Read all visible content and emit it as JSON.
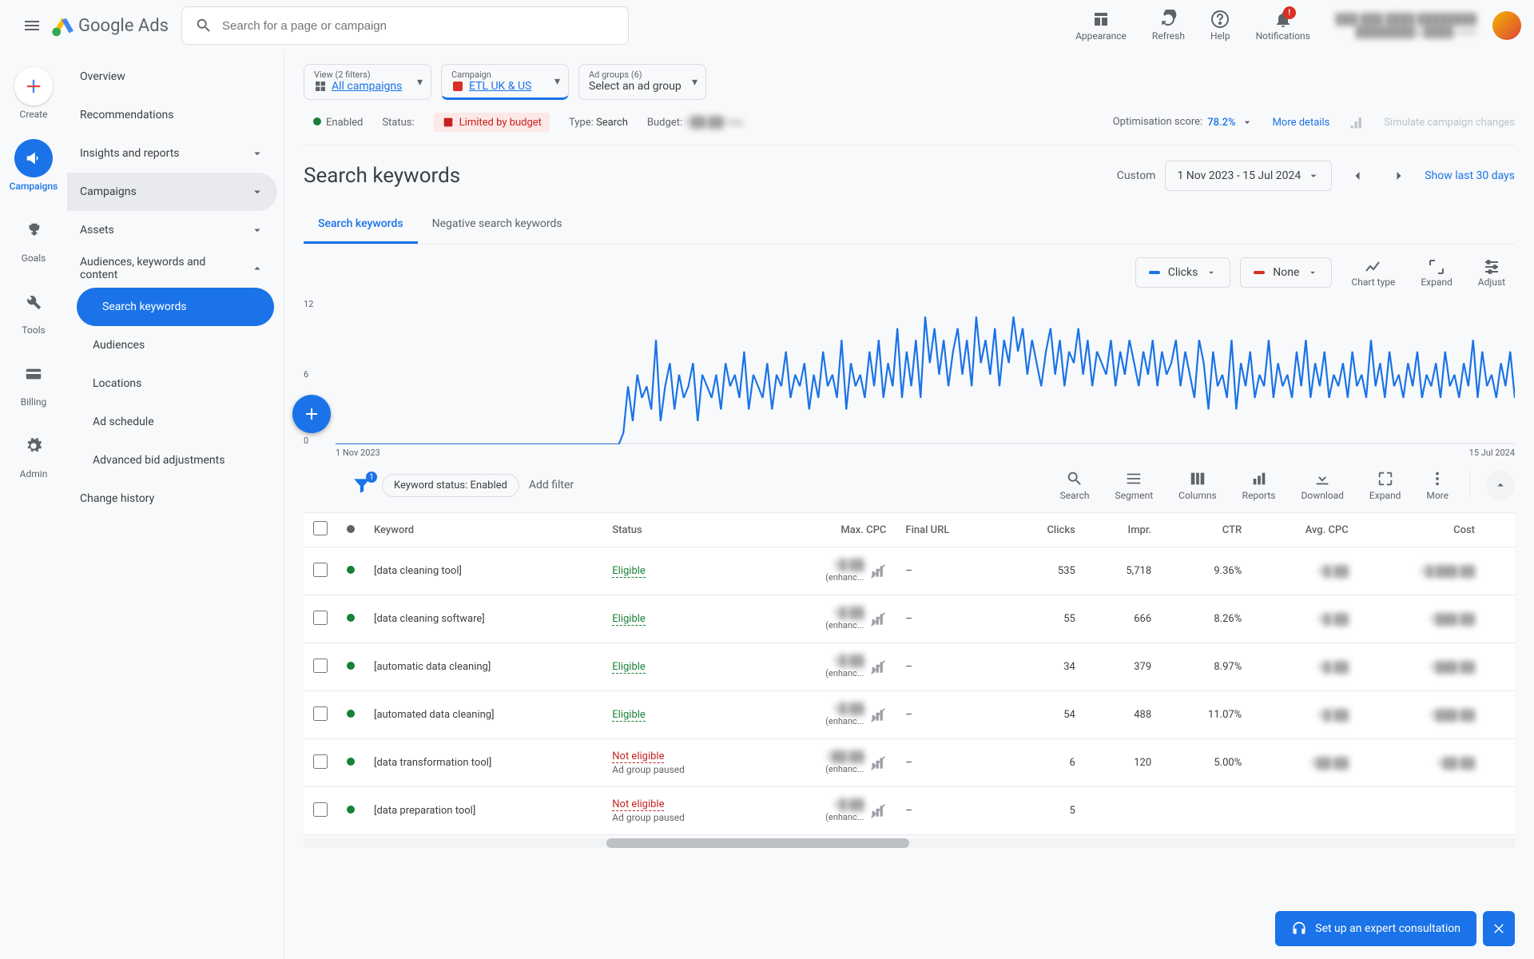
{
  "header": {
    "logo_text": "Google Ads",
    "search_placeholder": "Search for a page or campaign",
    "actions": {
      "appearance": "Appearance",
      "refresh": "Refresh",
      "help": "Help",
      "notifications": "Notifications"
    },
    "account_line1": "███-███-████ ████████",
    "account_line2": "████████@████.com"
  },
  "rail": {
    "create": "Create",
    "campaigns": "Campaigns",
    "goals": "Goals",
    "tools": "Tools",
    "billing": "Billing",
    "admin": "Admin"
  },
  "nav": {
    "overview": "Overview",
    "recommendations": "Recommendations",
    "insights": "Insights and reports",
    "campaigns": "Campaigns",
    "assets": "Assets",
    "audiences_kw": "Audiences, keywords and content",
    "search_keywords": "Search keywords",
    "audiences": "Audiences",
    "locations": "Locations",
    "ad_schedule": "Ad schedule",
    "advanced_bid": "Advanced bid adjustments",
    "change_history": "Change history"
  },
  "context": {
    "view_label": "View (2 filters)",
    "view_value": "All campaigns",
    "campaign_label": "Campaign",
    "campaign_value": "ETL UK & US",
    "adgroups_label": "Ad groups (6)",
    "adgroups_value": "Select an ad group"
  },
  "status": {
    "enabled": "Enabled",
    "status_label": "Status:",
    "limited": "Limited by budget",
    "type_label": "Type:",
    "type_value": "Search",
    "budget_label": "Budget:",
    "budget_value": "€██.██/day",
    "opt_label": "Optimisation score:",
    "opt_value": "78.2%",
    "more_details": "More details",
    "simulate": "Simulate campaign changes"
  },
  "title": {
    "page_title": "Search keywords",
    "custom": "Custom",
    "date_range": "1 Nov 2023 - 15 Jul 2024",
    "show_last": "Show last 30 days"
  },
  "tabs": {
    "search_kw": "Search keywords",
    "negative_kw": "Negative search keywords"
  },
  "chart_ctrl": {
    "metric1": "Clicks",
    "metric2": "None",
    "chart_type": "Chart type",
    "expand": "Expand",
    "adjust": "Adjust"
  },
  "chart_data": {
    "type": "line",
    "title": "",
    "xlabel": "",
    "ylabel": "",
    "ylim": [
      0,
      12
    ],
    "y_ticks": [
      0,
      6,
      12
    ],
    "x_start": "1 Nov 2023",
    "x_end": "15 Jul 2024",
    "series": [
      {
        "name": "Clicks",
        "color": "#1a73e8",
        "values": [
          0,
          0,
          0,
          0,
          0,
          0,
          0,
          0,
          0,
          0,
          0,
          0,
          0,
          0,
          0,
          0,
          0,
          0,
          0,
          0,
          0,
          0,
          0,
          0,
          0,
          0,
          0,
          0,
          0,
          0,
          0,
          0,
          0,
          0,
          0,
          0,
          0,
          0,
          0,
          0,
          0,
          0,
          0,
          0,
          0,
          0,
          0,
          0,
          0,
          0,
          0,
          0,
          0,
          0,
          0,
          0,
          0,
          0,
          0,
          0,
          0,
          0,
          1,
          5,
          2,
          6,
          4,
          5,
          3,
          9,
          2,
          5,
          7,
          3,
          6,
          4,
          5,
          7,
          2,
          6,
          5,
          4,
          6,
          3,
          7,
          5,
          6,
          4,
          8,
          3,
          6,
          5,
          4,
          7,
          3,
          6,
          5,
          8,
          4,
          6,
          5,
          7,
          3,
          6,
          4,
          8,
          5,
          6,
          4,
          9,
          3,
          7,
          5,
          6,
          4,
          8,
          5,
          9,
          4,
          7,
          5,
          10,
          4,
          8,
          5,
          9,
          4,
          11,
          7,
          10,
          6,
          9,
          5,
          8,
          10,
          6,
          9,
          5,
          11,
          7,
          9,
          6,
          10,
          5,
          9,
          7,
          11,
          8,
          10,
          6,
          9,
          7,
          5,
          8,
          10,
          6,
          9,
          5,
          8,
          7,
          10,
          6,
          9,
          5,
          8,
          7,
          6,
          9,
          5,
          8,
          6,
          9,
          7,
          5,
          8,
          6,
          9,
          5,
          8,
          6,
          7,
          9,
          5,
          8,
          6,
          4,
          9,
          7,
          3,
          8,
          5,
          6,
          4,
          9,
          3,
          7,
          5,
          8,
          4,
          6,
          5,
          9,
          4,
          7,
          5,
          6,
          4,
          8,
          5,
          9,
          4,
          7,
          5,
          8,
          4,
          6,
          5,
          7,
          4,
          8,
          5,
          6,
          4,
          9,
          5,
          7,
          4,
          8,
          5,
          6,
          4,
          7,
          5,
          8,
          4,
          6,
          5,
          7,
          4,
          8,
          5,
          6,
          4,
          7,
          5,
          9,
          4,
          8,
          5,
          6,
          4,
          7,
          5,
          8,
          4
        ]
      }
    ]
  },
  "toolbar": {
    "filter_count": "1",
    "filter_chip": "Keyword status: Enabled",
    "add_filter": "Add filter",
    "search": "Search",
    "segment": "Segment",
    "columns": "Columns",
    "reports": "Reports",
    "download": "Download",
    "expand": "Expand",
    "more": "More"
  },
  "table": {
    "headers": {
      "keyword": "Keyword",
      "status": "Status",
      "maxcpc": "Max. CPC",
      "finalurl": "Final URL",
      "clicks": "Clicks",
      "impr": "Impr.",
      "ctr": "CTR",
      "avgcpc": "Avg. CPC",
      "cost": "Cost"
    },
    "rows": [
      {
        "keyword": "[data cleaning tool]",
        "status": "Eligible",
        "status_ok": true,
        "maxcpc": "€█.██",
        "maxcpc_sub": "(enhanc...",
        "finalurl": "–",
        "clicks": "535",
        "impr": "5,718",
        "ctr": "9.36%",
        "avgcpc": "€█.██",
        "cost": "€█,███.██"
      },
      {
        "keyword": "[data cleaning software]",
        "status": "Eligible",
        "status_ok": true,
        "maxcpc": "€█.██",
        "maxcpc_sub": "(enhanc...",
        "finalurl": "–",
        "clicks": "55",
        "impr": "666",
        "ctr": "8.26%",
        "avgcpc": "€█.██",
        "cost": "€███.██"
      },
      {
        "keyword": "[automatic data cleaning]",
        "status": "Eligible",
        "status_ok": true,
        "maxcpc": "€█.██",
        "maxcpc_sub": "(enhanc...",
        "finalurl": "–",
        "clicks": "34",
        "impr": "379",
        "ctr": "8.97%",
        "avgcpc": "€█.██",
        "cost": "€███.██"
      },
      {
        "keyword": "[automated data cleaning]",
        "status": "Eligible",
        "status_ok": true,
        "maxcpc": "€█.██",
        "maxcpc_sub": "(enhanc...",
        "finalurl": "–",
        "clicks": "54",
        "impr": "488",
        "ctr": "11.07%",
        "avgcpc": "€█.██",
        "cost": "€███.██"
      },
      {
        "keyword": "[data transformation tool]",
        "status": "Not eligible",
        "status_ok": false,
        "status_sub": "Ad group paused",
        "maxcpc": "€██.██",
        "maxcpc_sub": "(enhanc...",
        "finalurl": "–",
        "clicks": "6",
        "impr": "120",
        "ctr": "5.00%",
        "avgcpc": "€██.██",
        "cost": "€██.██"
      },
      {
        "keyword": "[data preparation tool]",
        "status": "Not eligible",
        "status_ok": false,
        "status_sub": "Ad group paused",
        "maxcpc": "€█.██",
        "maxcpc_sub": "(enhanc...",
        "finalurl": "–",
        "clicks": "5",
        "impr": "",
        "ctr": "",
        "avgcpc": "",
        "cost": ""
      }
    ]
  },
  "banner": {
    "text": "Set up an expert consultation"
  }
}
